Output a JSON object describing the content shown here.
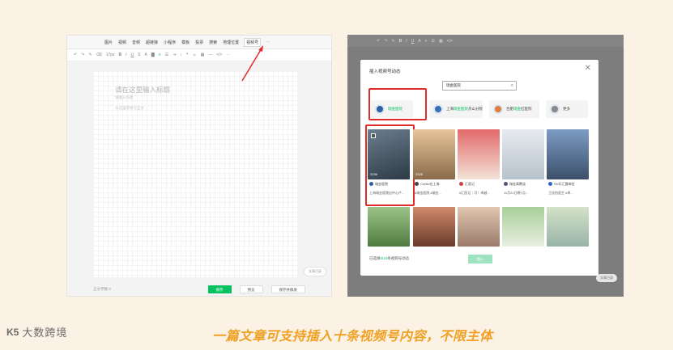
{
  "left_editor": {
    "menu_items": [
      "图片",
      "视频",
      "音频",
      "超链接",
      "小程序",
      "模板",
      "投票",
      "搜索",
      "地理位置",
      "视频号",
      "⋯"
    ],
    "highlight_menu": "视频号",
    "toolbar_font_size": "17px",
    "toolbar_icons": [
      "undo-icon",
      "redo-icon",
      "format-brush-icon",
      "clear-format-icon",
      "bold-icon",
      "italic-icon",
      "underline-icon",
      "strike-icon",
      "font-color-icon",
      "background-color-icon",
      "align-icon",
      "list-icon",
      "indent-icon",
      "table-icon",
      "divider-icon",
      "code-icon",
      "more-icon"
    ],
    "title_placeholder": "请在这里输入标题",
    "author_placeholder": "请输入作者",
    "body_placeholder": "从这里开始写正文",
    "side_pill": "文章目录",
    "word_count": "正文字数 0",
    "save_btn": "保存",
    "preview_btn": "预览",
    "publish_btn": "保存并群发"
  },
  "dialog": {
    "title": "插入视频号动态",
    "close": "✕",
    "search_value": "瑞金医院",
    "accounts": [
      {
        "name_pre": "",
        "name_hl": "瑞金医院",
        "name_post": "",
        "color": "#2f5fa3"
      },
      {
        "name_pre": "上海",
        "name_hl": "瑞金医院",
        "name_post": "舟山分院",
        "color": "#3a6fb5"
      },
      {
        "name_pre": "合肥",
        "name_hl": "瑞金",
        "name_post": "红医院",
        "color": "#e07b3a"
      },
      {
        "name_pre": "",
        "name_hl": "",
        "name_post": "更多",
        "color": "#888888"
      }
    ],
    "cards": [
      {
        "cover": "#4a5a6a",
        "count": "2036",
        "author": "瑞金医院",
        "desc": "上海瑞金医院出中心产..."
      },
      {
        "cover": "#c99a6c",
        "count": "3328",
        "author": "Cerlito在上海",
        "desc": "#瑞金医院  #瑞金..."
      },
      {
        "cover": "#d35a5a",
        "count": "",
        "author": "汇医记",
        "desc": "#汇医记｜可！卓越..."
      },
      {
        "cover": "#cfd6dc",
        "count": "",
        "author": "瑞金高瞻谈",
        "desc": "11月21日晚7点..."
      },
      {
        "cover": "#6f8fb6",
        "count": "",
        "author": "SH乐汇健体验",
        "desc": "王佳怡医生 #卓..."
      }
    ],
    "second_row_colors": [
      "#6aa05a",
      "#b85a3a",
      "#c9a28a",
      "#7aa86a",
      "#b9c9a8"
    ],
    "selected_note_pre": "已选择",
    "selected_note_count": "0/10",
    "selected_note_post": "条视频号动态",
    "confirm": "插入"
  },
  "right_side_pill": "文章目录",
  "brand_logo": "K5",
  "brand_text": "大数跨境",
  "caption": "一篇文章可支持插入十条视频号内容，不限主体"
}
